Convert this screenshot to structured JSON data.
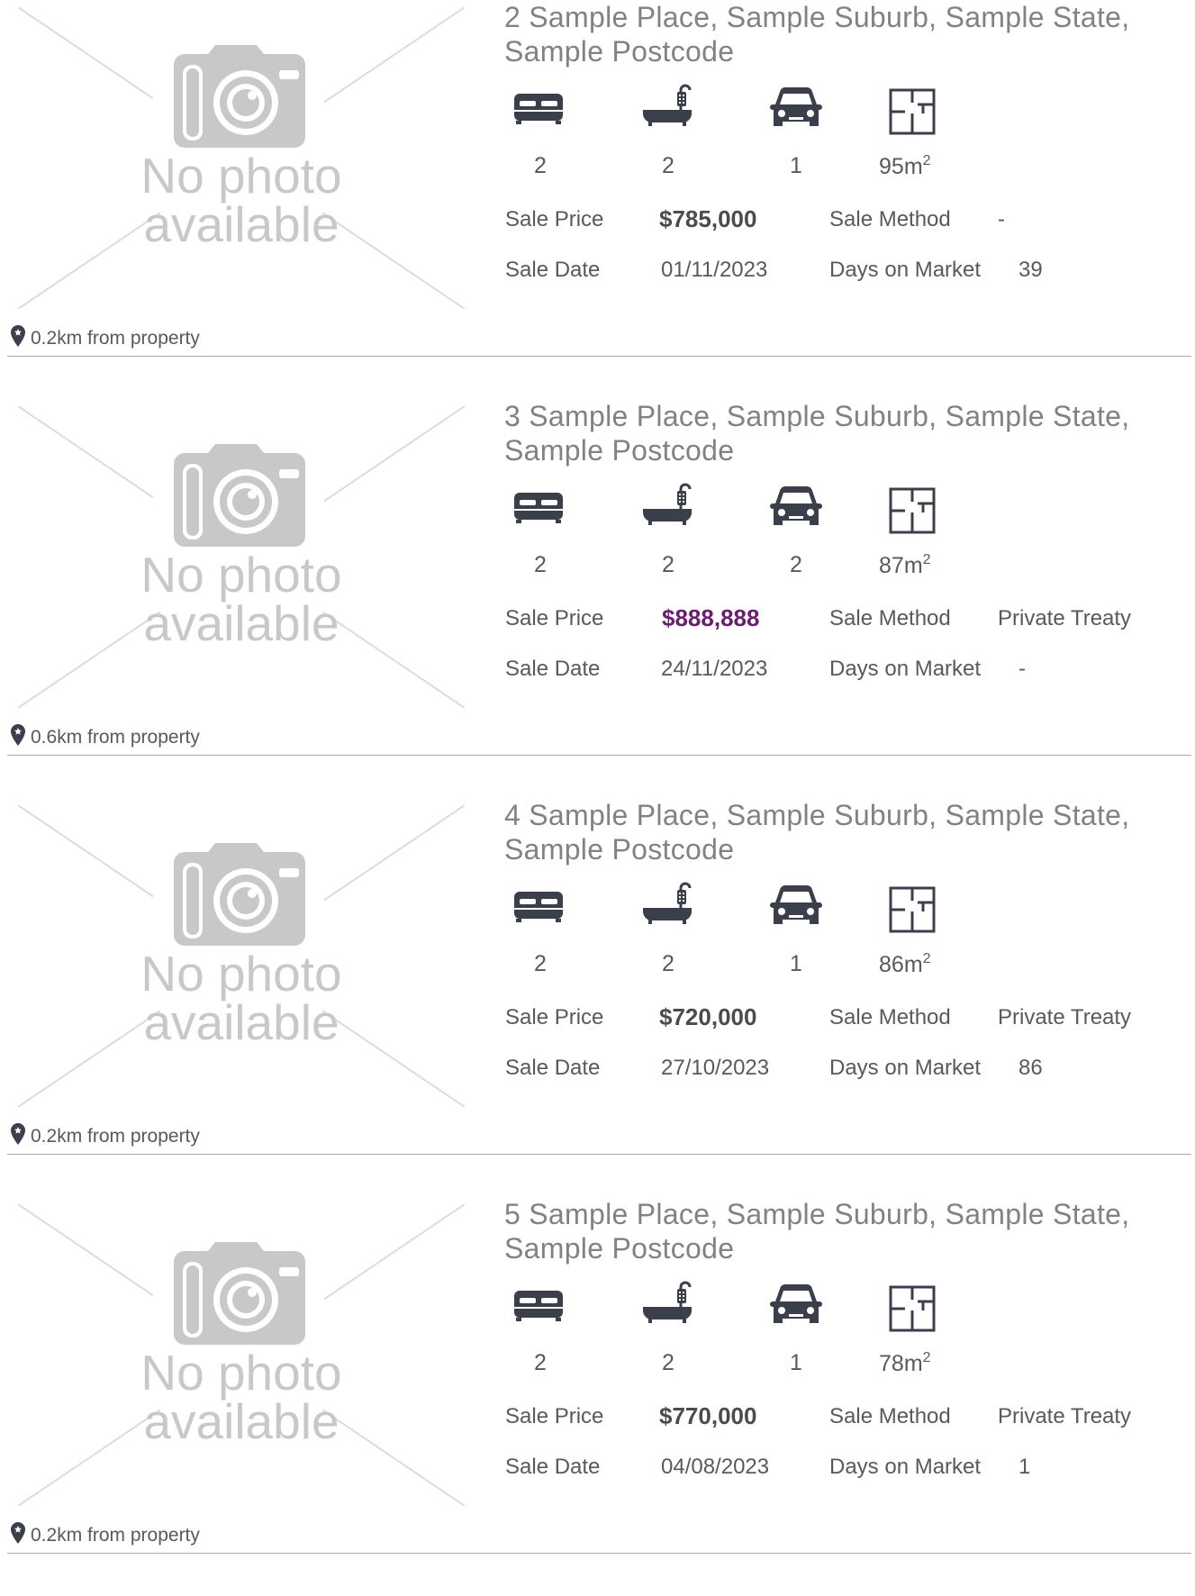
{
  "colors": {
    "text": "#58595b",
    "address": "#808285",
    "icon": "#3a3f4b",
    "placeholder": "#c8c8c8",
    "divider": "#a7a9ac",
    "price_highlight": "#6b1d6f"
  },
  "labels": {
    "no_photo_line1": "No photo",
    "no_photo_line2": "available",
    "sale_price": "Sale Price",
    "sale_method": "Sale Method",
    "sale_date": "Sale Date",
    "days_on_market": "Days on Market",
    "area_unit": "m",
    "area_sup": "2"
  },
  "icons": [
    "bed-icon",
    "bath-icon",
    "car-icon",
    "floorplan-icon",
    "location-pin-icon",
    "camera-icon"
  ],
  "listings": [
    {
      "address": "2 Sample Place, Sample Suburb, Sample State, Sample Postcode",
      "beds": "2",
      "baths": "2",
      "cars": "1",
      "area": "95",
      "sale_price": "$785,000",
      "price_highlight": false,
      "sale_method": "-",
      "sale_date": "01/11/2023",
      "days_on_market": "39",
      "distance": "0.2km from property"
    },
    {
      "address": "3 Sample Place, Sample Suburb, Sample State, Sample Postcode",
      "beds": "2",
      "baths": "2",
      "cars": "2",
      "area": "87",
      "sale_price": "$888,888",
      "price_highlight": true,
      "sale_method": "Private Treaty",
      "sale_date": "24/11/2023",
      "days_on_market": "-",
      "distance": "0.6km from property"
    },
    {
      "address": "4 Sample Place, Sample Suburb, Sample State, Sample Postcode",
      "beds": "2",
      "baths": "2",
      "cars": "1",
      "area": "86",
      "sale_price": "$720,000",
      "price_highlight": false,
      "sale_method": "Private Treaty",
      "sale_date": "27/10/2023",
      "days_on_market": "86",
      "distance": "0.2km from property"
    },
    {
      "address": "5 Sample Place, Sample Suburb, Sample State, Sample Postcode",
      "beds": "2",
      "baths": "2",
      "cars": "1",
      "area": "78",
      "sale_price": "$770,000",
      "price_highlight": false,
      "sale_method": "Private Treaty",
      "sale_date": "04/08/2023",
      "days_on_market": "1",
      "distance": "0.2km from property"
    }
  ]
}
